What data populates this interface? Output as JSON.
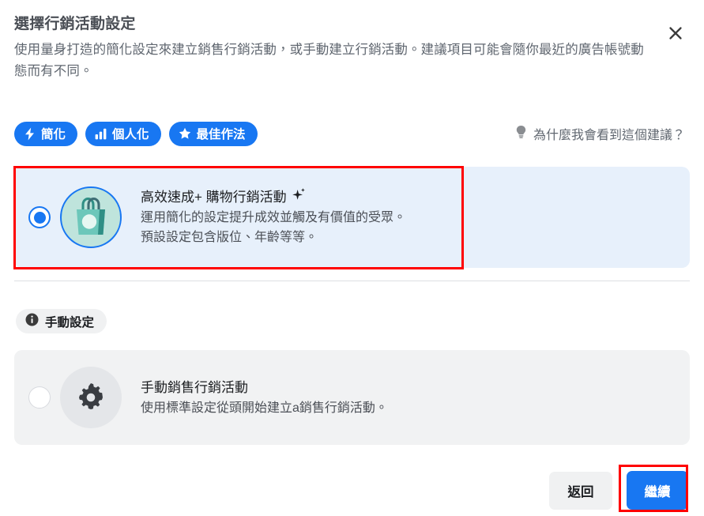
{
  "dialog": {
    "title": "選擇行銷活動設定",
    "subtitle": "使用量身打造的簡化設定來建立銷售行銷活動，或手動建立行銷活動。建議項目可能會隨你最近的廣告帳號動態而有不同。",
    "close_label": "✕",
    "close_icon": "close-icon"
  },
  "badges": [
    {
      "label": "簡化",
      "icon": "lightning-bolt-icon",
      "color": "#1877f2"
    },
    {
      "label": "個人化",
      "icon": "bar-chart-icon",
      "color": "#1877f2"
    },
    {
      "label": "最佳作法",
      "icon": "star-icon",
      "color": "#1877f2"
    }
  ],
  "why_link": {
    "label": "為什麼我會看到這個建議？",
    "icon": "lightbulb-icon"
  },
  "options": [
    {
      "id": "advantage-plus-shopping",
      "title": "高效速成+ 購物行銷活動",
      "title_badge_icon": "sparkle-icon",
      "desc_line1": "運用簡化的設定提升成效並觸及有價值的受眾。",
      "desc_line2": "預設設定包含版位、年齡等等。",
      "selected": true,
      "thumb_icon": "shopping-bag-icon",
      "bg_color": "#e7f0fb"
    },
    {
      "id": "manual-sales-campaign",
      "title": "手動銷售行銷活動",
      "desc_line1": "使用標準設定從頭開始建立a銷售行銷活動。",
      "desc_line2": "",
      "selected": false,
      "thumb_icon": "gear-icon",
      "bg_color": "#f1f2f3"
    }
  ],
  "manual_section": {
    "pill_label": "手動設定",
    "pill_icon": "info-icon"
  },
  "footer": {
    "back_label": "返回",
    "continue_label": "繼續"
  },
  "annotations": {
    "highlight_color": "#ff0000",
    "boxes": [
      "selected-option-card",
      "continue-button"
    ]
  }
}
